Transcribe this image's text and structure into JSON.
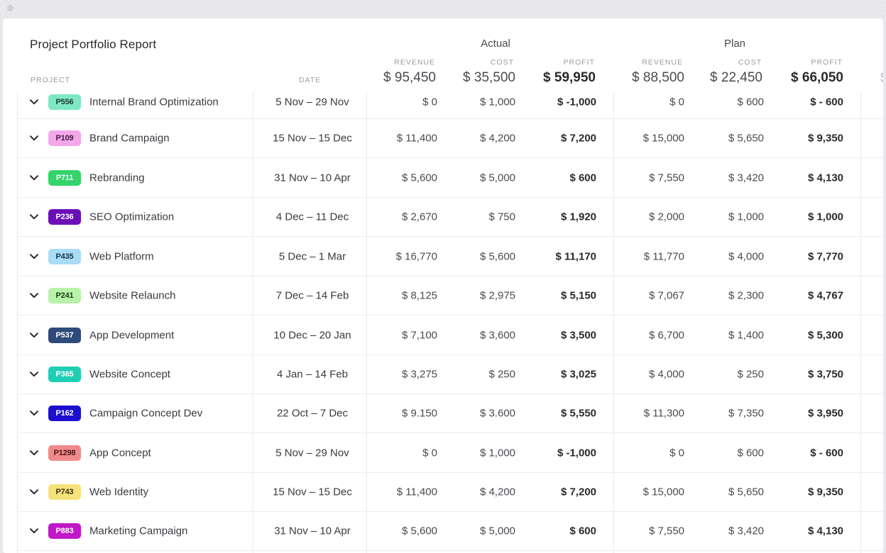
{
  "report": {
    "title": "Project Portfolio Report",
    "groups": {
      "actual": "Actual",
      "plan": "Plan"
    },
    "col_labels": {
      "project": "PROJECT",
      "date": "DATE",
      "revenue": "REVENUE",
      "cost": "COST",
      "profit": "PROFIT"
    },
    "totals": {
      "actual": {
        "revenue": "$ 95,450",
        "cost": "$ 35,500",
        "profit": "$ 59,950"
      },
      "plan": {
        "revenue": "$ 88,500",
        "cost": "$ 22,450",
        "profit": "$ 66,050"
      },
      "next_partial": "$"
    }
  },
  "rows": [
    {
      "code": "P556",
      "badge_bg": "#7ee8c4",
      "badge_fg": "#1b3d33",
      "name": "Internal Brand Optimization",
      "date": "5 Nov – 29 Nov",
      "a_rev": "$ 0",
      "a_cost": "$ 1,000",
      "a_profit": "$ -1,000",
      "p_rev": "$ 0",
      "p_cost": "$ 600",
      "p_profit": "$ - 600"
    },
    {
      "code": "P109",
      "badge_bg": "#f2a7ea",
      "badge_fg": "#4a1844",
      "name": "Brand Campaign",
      "date": "15 Nov – 15 Dec",
      "a_rev": "$ 11,400",
      "a_cost": "$ 4,200",
      "a_profit": "$ 7,200",
      "p_rev": "$ 15,000",
      "p_cost": "$ 5,650",
      "p_profit": "$ 9,350"
    },
    {
      "code": "P711",
      "badge_bg": "#33d46a",
      "badge_fg": "#ffffff",
      "name": "Rebranding",
      "date": "31 Nov – 10 Apr",
      "a_rev": "$ 5,600",
      "a_cost": "$ 5,000",
      "a_profit": "$ 600",
      "p_rev": "$ 7,550",
      "p_cost": "$ 3,420",
      "p_profit": "$ 4,130"
    },
    {
      "code": "P236",
      "badge_bg": "#6a0fb8",
      "badge_fg": "#ffffff",
      "name": "SEO Optimization",
      "date": "4 Dec – 11 Dec",
      "a_rev": "$ 2,670",
      "a_cost": "$ 750",
      "a_profit": "$ 1,920",
      "p_rev": "$ 2,000",
      "p_cost": "$ 1,000",
      "p_profit": "$ 1,000"
    },
    {
      "code": "P435",
      "badge_bg": "#a9dcf7",
      "badge_fg": "#173548",
      "name": "Web Platform",
      "date": "5 Dec – 1 Mar",
      "a_rev": "$ 16,770",
      "a_cost": "$ 5,600",
      "a_profit": "$ 11,170",
      "p_rev": "$ 11,770",
      "p_cost": "$ 4,000",
      "p_profit": "$ 7,770"
    },
    {
      "code": "P241",
      "badge_bg": "#b7f3a8",
      "badge_fg": "#1f3d18",
      "name": "Website Relaunch",
      "date": "7 Dec – 14 Feb",
      "a_rev": "$ 8,125",
      "a_cost": "$ 2,975",
      "a_profit": "$ 5,150",
      "p_rev": "$ 7,067",
      "p_cost": "$ 2,300",
      "p_profit": "$ 4,767"
    },
    {
      "code": "P537",
      "badge_bg": "#2e4a7a",
      "badge_fg": "#ffffff",
      "name": "App Development",
      "date": "10 Dec – 20 Jan",
      "a_rev": "$ 7,100",
      "a_cost": "$ 3,600",
      "a_profit": "$ 3,500",
      "p_rev": "$ 6,700",
      "p_cost": "$ 1,400",
      "p_profit": "$ 5,300"
    },
    {
      "code": "P365",
      "badge_bg": "#1fcfb4",
      "badge_fg": "#ffffff",
      "name": "Website Concept",
      "date": "4 Jan – 14 Feb",
      "a_rev": "$ 3,275",
      "a_cost": "$ 250",
      "a_profit": "$ 3,025",
      "p_rev": "$ 4,000",
      "p_cost": "$ 250",
      "p_profit": "$ 3,750"
    },
    {
      "code": "P162",
      "badge_bg": "#1d0fd0",
      "badge_fg": "#ffffff",
      "name": "Campaign Concept Dev",
      "date": "22 Oct – 7 Dec",
      "a_rev": "$ 9.150",
      "a_cost": "$ 3.600",
      "a_profit": "$ 5,550",
      "p_rev": "$ 11,300",
      "p_cost": "$ 7,350",
      "p_profit": "$ 3,950"
    },
    {
      "code": "P1298",
      "badge_bg": "#f08a8a",
      "badge_fg": "#4a1414",
      "name": "App Concept",
      "date": "5 Nov – 29 Nov",
      "a_rev": "$ 0",
      "a_cost": "$ 1,000",
      "a_profit": "$ -1,000",
      "p_rev": "$ 0",
      "p_cost": "$ 600",
      "p_profit": "$ - 600"
    },
    {
      "code": "P743",
      "badge_bg": "#f6e27a",
      "badge_fg": "#3d3410",
      "name": "Web Identity",
      "date": "15 Nov – 15 Dec",
      "a_rev": "$ 11,400",
      "a_cost": "$ 4,200",
      "a_profit": "$ 7,200",
      "p_rev": "$ 15,000",
      "p_cost": "$ 5,650",
      "p_profit": "$ 9,350"
    },
    {
      "code": "P883",
      "badge_bg": "#c316c9",
      "badge_fg": "#ffffff",
      "name": "Marketing Campaign",
      "date": "31 Nov – 10 Apr",
      "a_rev": "$ 5,600",
      "a_cost": "$ 5,000",
      "a_profit": "$ 600",
      "p_rev": "$ 7,550",
      "p_cost": "$ 3,420",
      "p_profit": "$ 4,130"
    }
  ]
}
